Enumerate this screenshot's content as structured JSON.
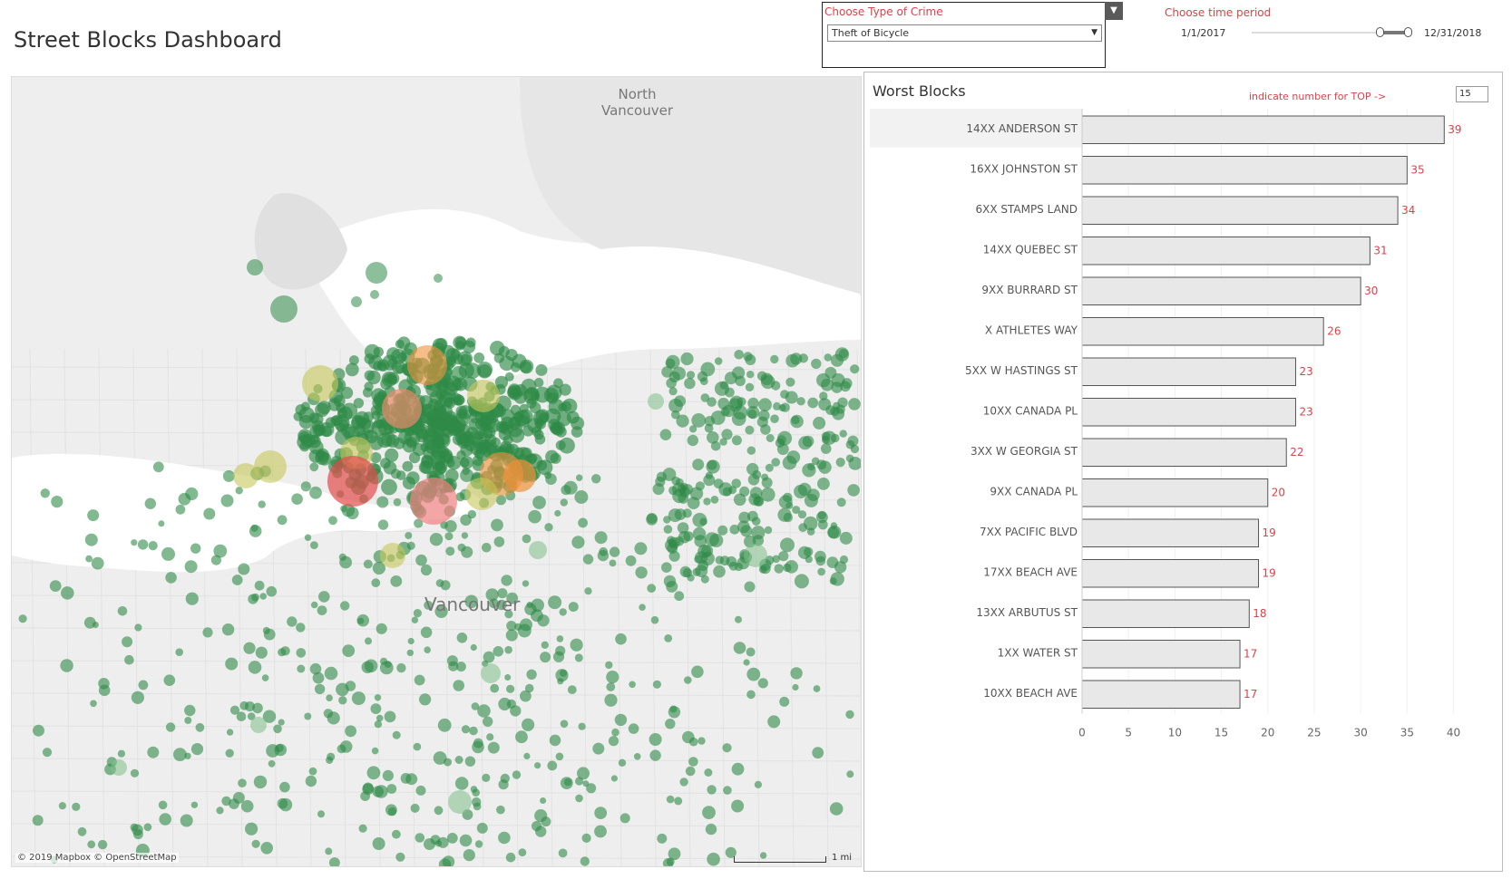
{
  "dashboard": {
    "title": "Street Blocks Dashboard"
  },
  "crime_filter": {
    "label": "Choose Type of Crime",
    "selected": "Theft of Bicycle",
    "menu_icon": "dropdown-caret-icon"
  },
  "time_filter": {
    "label": "Choose time period",
    "start": "1/1/2017",
    "end": "12/31/2018",
    "selected_fraction_start": 0.82,
    "selected_fraction_end": 1.0
  },
  "map": {
    "labels": {
      "north_vancouver": "North\nVancouver",
      "vancouver": "Vancouver"
    },
    "credit": "© 2019 Mapbox © OpenStreetMap",
    "scale": "1 mi",
    "colors": {
      "low": "#2e8b47",
      "mid": "#c8c85a",
      "high": "#e24b4b",
      "orange": "#f0913a",
      "water": "#ffffff",
      "land": "#eeeeee"
    }
  },
  "worst_blocks": {
    "title": "Worst Blocks",
    "top_label": "indicate number for TOP ->",
    "top_n": "15"
  },
  "chart_data": {
    "type": "bar",
    "orientation": "horizontal",
    "categories": [
      "14XX ANDERSON ST",
      "16XX JOHNSTON ST",
      "6XX STAMPS LAND",
      "14XX QUEBEC ST",
      "9XX BURRARD ST",
      "X ATHLETES WAY",
      "5XX W HASTINGS ST",
      "10XX CANADA PL",
      "3XX W GEORGIA ST",
      "9XX CANADA PL",
      "7XX PACIFIC BLVD",
      "17XX BEACH AVE",
      "13XX ARBUTUS ST",
      "1XX WATER ST",
      "10XX BEACH AVE"
    ],
    "values": [
      39,
      35,
      34,
      31,
      30,
      26,
      23,
      23,
      22,
      20,
      19,
      19,
      18,
      17,
      17
    ],
    "xlim": [
      0,
      42
    ],
    "xticks": [
      0,
      5,
      10,
      15,
      20,
      25,
      30,
      35,
      40
    ],
    "bar_color": "#e8e8e8",
    "label_color": "#d9434a",
    "highlighted_index": 0
  }
}
